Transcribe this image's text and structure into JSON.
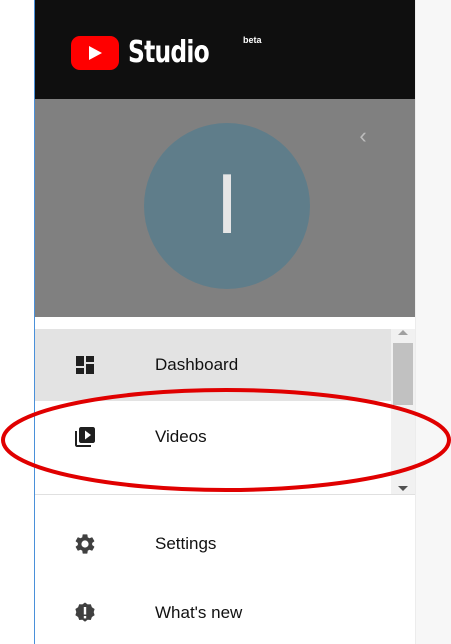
{
  "header": {
    "logo_text": "Studio",
    "logo_badge": "beta",
    "logo_icon": "youtube-play-logo"
  },
  "profile": {
    "avatar_letter": "I",
    "avatar_color": "#5f7d8a",
    "collapse_icon": "chevron-left-icon"
  },
  "nav": {
    "items": [
      {
        "label": "Dashboard",
        "icon": "dashboard-icon",
        "selected": true
      },
      {
        "label": "Videos",
        "icon": "video-library-icon",
        "selected": false
      }
    ],
    "footer_items": [
      {
        "label": "Settings",
        "icon": "gear-icon"
      },
      {
        "label": "What's new",
        "icon": "whats-new-badge-icon"
      }
    ]
  },
  "annotation": {
    "shape": "ellipse",
    "color": "#e00000",
    "target": "Videos"
  },
  "colors": {
    "header_bg": "#0f0f0f",
    "brand_red": "#ff0000",
    "profile_bg": "#808080",
    "selected_bg": "#e3e3e3"
  }
}
